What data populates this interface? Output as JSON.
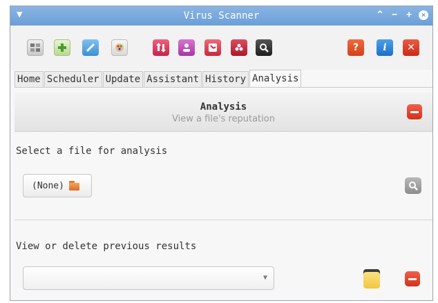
{
  "window": {
    "title": "Virus Scanner",
    "menu_icon": "menu-arrow-icon",
    "controls": [
      "^",
      "−",
      "+",
      "×"
    ]
  },
  "toolbar": {
    "left_icons": [
      "scan-device-icon",
      "add-file-icon",
      "tools-icon",
      "palette-icon"
    ],
    "center_icons": [
      "update-arrows-icon",
      "user-icon",
      "clock-icon",
      "quarantine-icon",
      "search-icon"
    ],
    "right_icons": [
      "help-icon",
      "info-icon",
      "close-icon"
    ],
    "help_label": "?",
    "info_label": "i",
    "close_label": "✕"
  },
  "tabs": [
    {
      "label": "Home"
    },
    {
      "label": "Scheduler"
    },
    {
      "label": "Update"
    },
    {
      "label": "Assistant"
    },
    {
      "label": "History"
    },
    {
      "label": "Analysis",
      "active": true
    }
  ],
  "header": {
    "title": "Analysis",
    "subtitle": "View a file's reputation"
  },
  "file_section": {
    "label": "Select a file for analysis",
    "file_button_label": "(None)"
  },
  "results_section": {
    "label": "View or delete previous results",
    "dropdown_value": ""
  },
  "colors": {
    "titlebar": "#6b9fd8",
    "danger": "#d2311c",
    "info": "#2a7bd5"
  }
}
